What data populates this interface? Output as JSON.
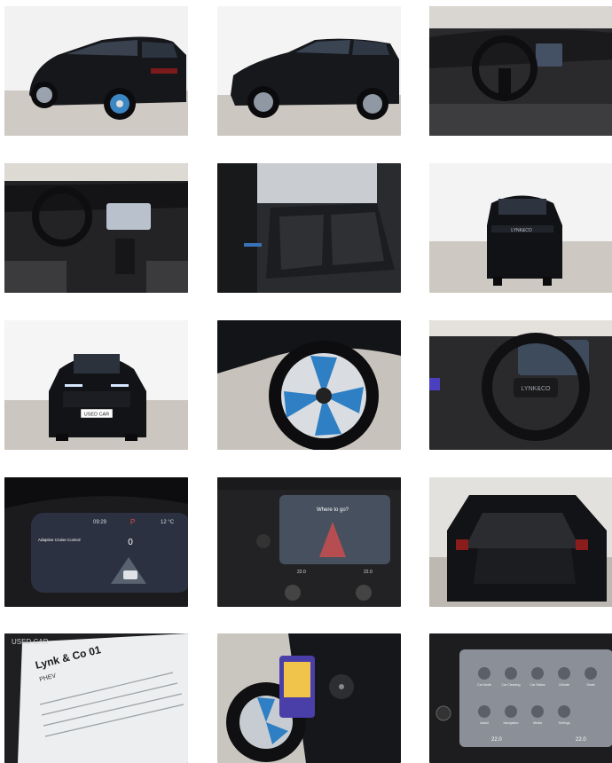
{
  "gallery": {
    "photos": [
      {
        "caption": "Exterior rear three-quarter view"
      },
      {
        "caption": "Exterior side profile"
      },
      {
        "caption": "Dashboard and steering wheel"
      },
      {
        "caption": "Interior cockpit and center console"
      },
      {
        "caption": "Rear seats"
      },
      {
        "caption": "Rear view"
      },
      {
        "caption": "Front view"
      },
      {
        "caption": "Wheel close-up"
      },
      {
        "caption": "Steering wheel close-up"
      },
      {
        "caption": "Digital instrument cluster"
      },
      {
        "caption": "Infotainment touchscreen"
      },
      {
        "caption": "Open trunk"
      },
      {
        "caption": "Used car information sheet"
      },
      {
        "caption": "Charging port with cable"
      },
      {
        "caption": "Touchscreen settings menu"
      }
    ]
  },
  "texts": {
    "front_plate": "USED CAR",
    "rear_badge": "LYNK&CO",
    "wheel_badge": "LYNK&CO",
    "cluster_time": "09:29",
    "cluster_gear": "P",
    "cluster_temp": "12 °C",
    "cluster_speed": "0",
    "cluster_acc": "Adaptive Cruise Control",
    "screen_prompt": "Where to go?",
    "screen_temp_left": "22.0",
    "screen_temp_right": "22.0",
    "sheet_header": "USED CAR",
    "sheet_title": "Lynk & Co 01",
    "sheet_subtitle": "PHEV",
    "settings_temp_left": "22.0",
    "settings_temp_right": "22.0",
    "settings_labels": [
      "Car Mode",
      "Car Cleaning",
      "Car Status",
      "Climate",
      "Seats",
      "Assist",
      "Navigation",
      "Media",
      "Settings"
    ]
  }
}
